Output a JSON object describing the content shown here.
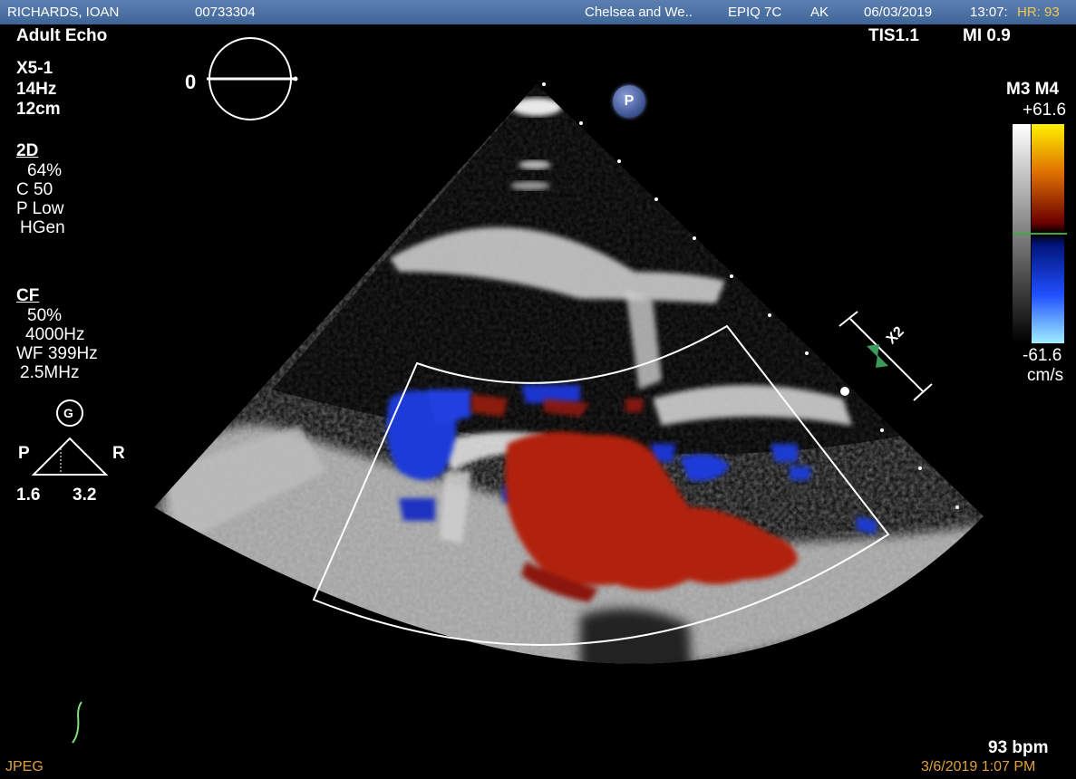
{
  "header": {
    "patient_name": "RICHARDS, IOAN",
    "patient_id": "00733304",
    "institution": "Chelsea and We..",
    "system": "EPIQ 7C",
    "operator": "AK",
    "date": "06/03/2019",
    "time": "13:07:",
    "hr": "HR: 93"
  },
  "exam": {
    "preset": "Adult Echo",
    "probe": "X5-1",
    "frame_rate": "14Hz",
    "depth": "12cm"
  },
  "safety": {
    "tis": "TIS1.1",
    "mi": "MI 0.9"
  },
  "mode_2d": {
    "title": "2D",
    "gain": "64%",
    "compression": "C 50",
    "power": "P Low",
    "freq": "HGen"
  },
  "mode_cf": {
    "title": "CF",
    "gain": "50%",
    "prf": "4000Hz",
    "wall_filter": "WF 399Hz",
    "freq": "2.5MHz"
  },
  "orientation": {
    "angle": "0"
  },
  "probe_marker": {
    "letter": "P"
  },
  "scale_indicator": {
    "letter": "G",
    "left_label": "P",
    "right_label": "R",
    "left_value": "1.6",
    "right_value": "3.2"
  },
  "zoom": {
    "label": "X2"
  },
  "colormap": {
    "title": "M3 M4",
    "max": "+61.6",
    "min": "-61.6",
    "unit": "cm/s"
  },
  "heart_rate": "93 bpm",
  "footer": {
    "format": "JPEG",
    "timestamp": "3/6/2019 1:07 PM"
  },
  "colors": {
    "header_bg": "#4a6fa5",
    "flow_red": "#b0200f",
    "flow_blue": "#1e3ad8",
    "annotation_orange": "#e0a040"
  }
}
